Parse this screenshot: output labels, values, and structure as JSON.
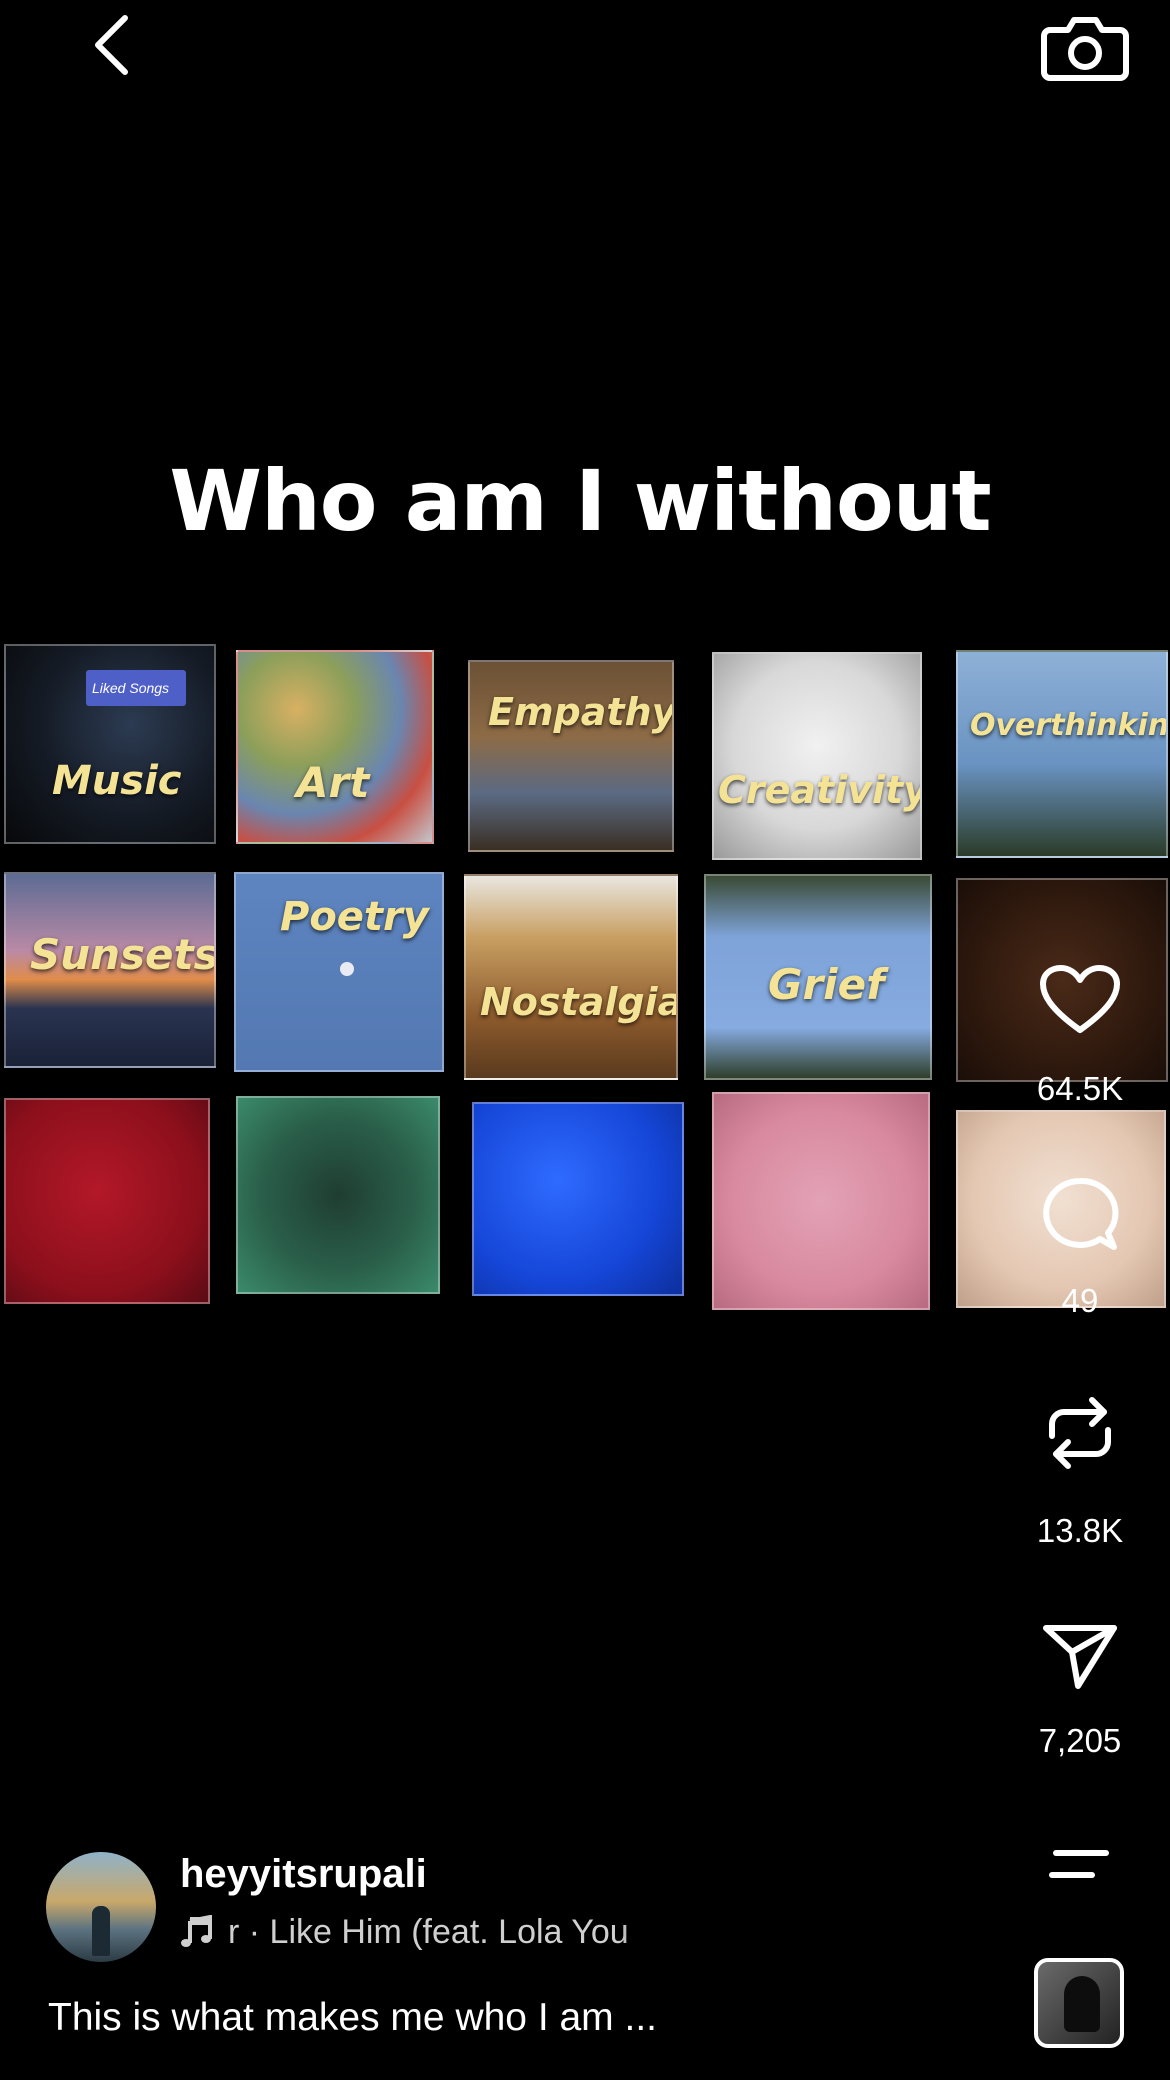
{
  "topbar": {
    "back_icon": "chevron-left-icon",
    "camera_icon": "camera-icon"
  },
  "headline": "Who am I without",
  "tiles": [
    {
      "label": "Music"
    },
    {
      "label": "Art"
    },
    {
      "label": "Empathy"
    },
    {
      "label": "Creativity"
    },
    {
      "label": "Overthinking"
    },
    {
      "label": "Sunsets"
    },
    {
      "label": "Poetry"
    },
    {
      "label": "Nostalgia"
    },
    {
      "label": "Grief"
    }
  ],
  "tile_inner_text": "Liked Songs",
  "rail": {
    "likes": "64.5K",
    "comments": "49",
    "reposts": "13.8K",
    "shares": "7,205",
    "like_icon": "heart-icon",
    "comment_icon": "comment-bubble-icon",
    "repost_icon": "repost-icon",
    "share_icon": "send-icon",
    "menu_icon": "menu-lines-icon"
  },
  "author": {
    "username": "heyyitsrupali"
  },
  "music": {
    "note_icon": "music-note-icon",
    "text": "r · Like Him (feat. Lola You"
  },
  "caption": "This is what makes me who I am ...",
  "colors": {
    "label_yellow": "#f4e394",
    "background": "#000000"
  }
}
